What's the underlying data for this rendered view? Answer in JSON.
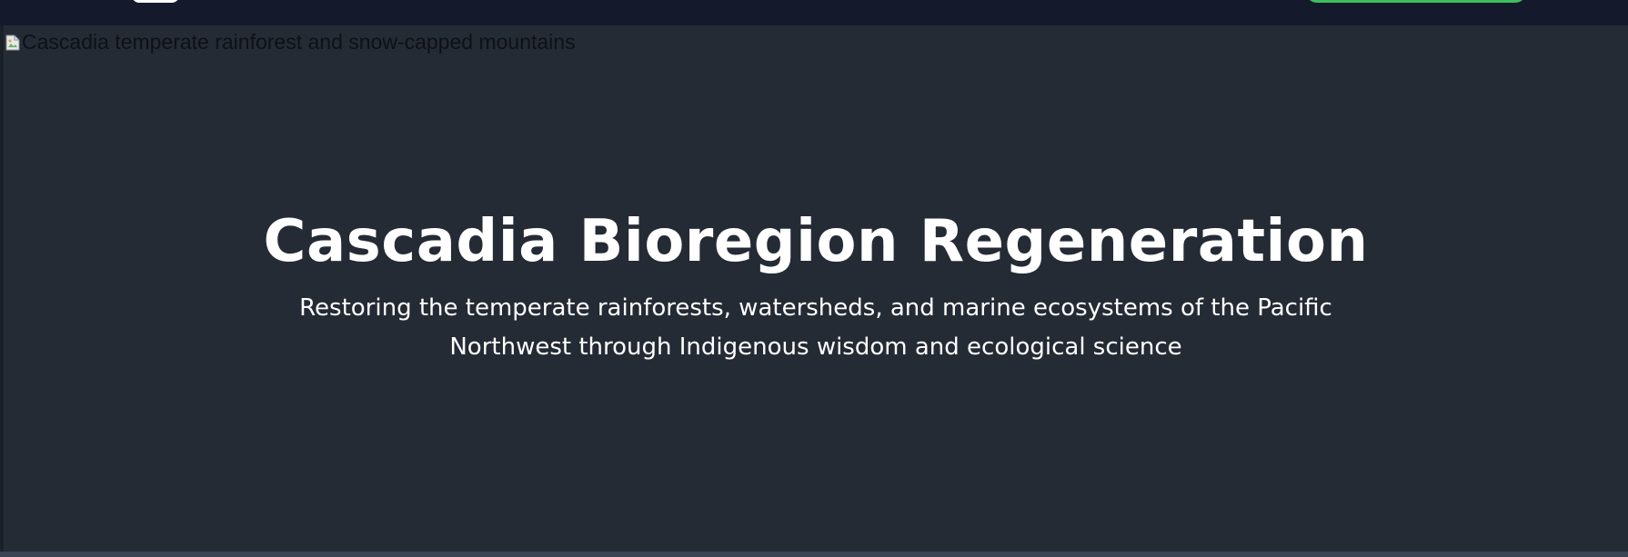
{
  "hero": {
    "image_alt": "Cascadia temperate rainforest and snow-capped mountains",
    "title": "Cascadia Bioregion Regeneration",
    "subtitle": "Restoring the temperate rainforests, watersheds, and marine ecosystems of the Pacific Northwest through Indigenous wisdom and ecological science"
  },
  "icons": {
    "broken_image": "broken-image-icon"
  },
  "colors": {
    "nav_background": "#141a2c",
    "hero_background": "#252b35",
    "cta_green": "#3fbf5b",
    "text": "#ffffff"
  }
}
